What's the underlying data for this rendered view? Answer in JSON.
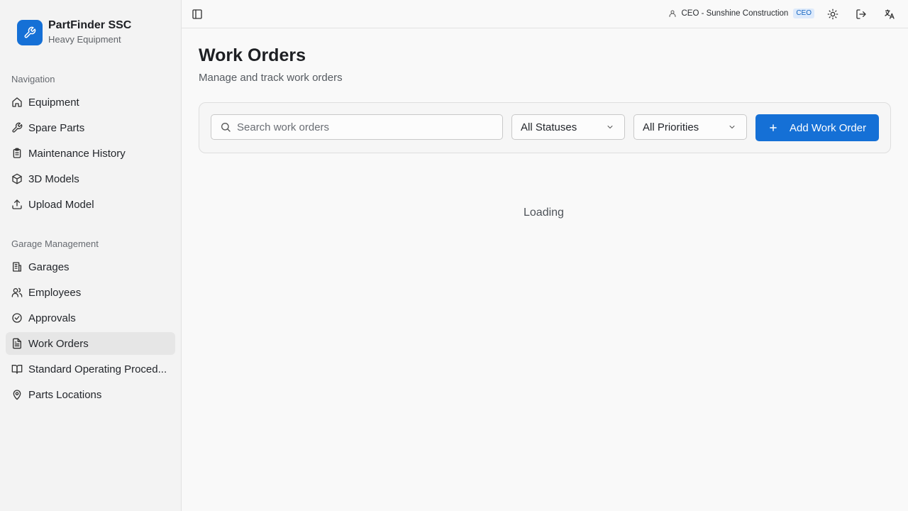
{
  "brand": {
    "name": "PartFinder SSC",
    "subtitle": "Heavy Equipment",
    "icon": "wrench-icon"
  },
  "sidebar": {
    "navigation_label": "Navigation",
    "navigation": [
      {
        "label": "Equipment",
        "icon": "home-icon"
      },
      {
        "label": "Spare Parts",
        "icon": "wrench-icon"
      },
      {
        "label": "Maintenance History",
        "icon": "clipboard-icon"
      },
      {
        "label": "3D Models",
        "icon": "cube-icon"
      },
      {
        "label": "Upload Model",
        "icon": "upload-icon"
      }
    ],
    "garage_label": "Garage Management",
    "garage": [
      {
        "label": "Garages",
        "icon": "building-icon"
      },
      {
        "label": "Employees",
        "icon": "users-icon"
      },
      {
        "label": "Approvals",
        "icon": "check-circle-icon"
      },
      {
        "label": "Work Orders",
        "icon": "document-icon",
        "active": true
      },
      {
        "label": "Standard Operating Proced...",
        "icon": "book-icon"
      },
      {
        "label": "Parts Locations",
        "icon": "map-pin-icon"
      }
    ]
  },
  "topbar": {
    "user": "CEO - Sunshine Construction",
    "role_badge": "CEO",
    "icons": [
      "sidebar-toggle-icon",
      "user-icon",
      "sun-icon",
      "logout-icon",
      "language-icon"
    ]
  },
  "page": {
    "title": "Work Orders",
    "subtitle": "Manage and track work orders"
  },
  "filters": {
    "search_placeholder": "Search work orders",
    "status_selected": "All Statuses",
    "priority_selected": "All Priorities",
    "add_button": "Add Work Order"
  },
  "status_text": "Loading",
  "colors": {
    "accent": "#1570d6",
    "badge_bg": "#ddeafb",
    "badge_text": "#1565c0"
  }
}
